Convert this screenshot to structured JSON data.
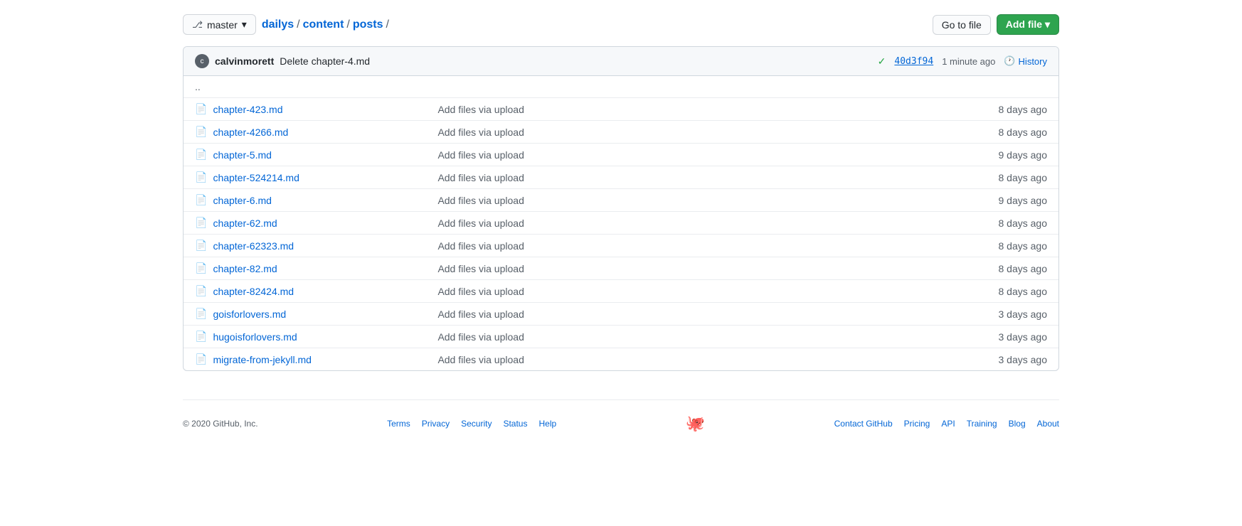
{
  "toolbar": {
    "branch": "master",
    "breadcrumb": [
      {
        "label": "dailys",
        "href": "#"
      },
      {
        "label": "content",
        "href": "#"
      },
      {
        "label": "posts",
        "href": "#"
      }
    ],
    "go_to_file_label": "Go to file",
    "add_file_label": "Add file ▾"
  },
  "commit_header": {
    "author": "calvinmorett",
    "message": "Delete chapter-4.md",
    "hash": "40d3f94",
    "time": "1 minute ago",
    "history_label": "History"
  },
  "parent_dir": "..",
  "files": [
    {
      "name": "chapter-423.md",
      "commit_msg": "Add files via upload",
      "time": "8 days ago"
    },
    {
      "name": "chapter-4266.md",
      "commit_msg": "Add files via upload",
      "time": "8 days ago"
    },
    {
      "name": "chapter-5.md",
      "commit_msg": "Add files via upload",
      "time": "9 days ago"
    },
    {
      "name": "chapter-524214.md",
      "commit_msg": "Add files via upload",
      "time": "8 days ago"
    },
    {
      "name": "chapter-6.md",
      "commit_msg": "Add files via upload",
      "time": "9 days ago"
    },
    {
      "name": "chapter-62.md",
      "commit_msg": "Add files via upload",
      "time": "8 days ago"
    },
    {
      "name": "chapter-62323.md",
      "commit_msg": "Add files via upload",
      "time": "8 days ago"
    },
    {
      "name": "chapter-82.md",
      "commit_msg": "Add files via upload",
      "time": "8 days ago"
    },
    {
      "name": "chapter-82424.md",
      "commit_msg": "Add files via upload",
      "time": "8 days ago"
    },
    {
      "name": "goisforlovers.md",
      "commit_msg": "Add files via upload",
      "time": "3 days ago"
    },
    {
      "name": "hugoisforlovers.md",
      "commit_msg": "Add files via upload",
      "time": "3 days ago"
    },
    {
      "name": "migrate-from-jekyll.md",
      "commit_msg": "Add files via upload",
      "time": "3 days ago"
    }
  ],
  "footer": {
    "copyright": "© 2020 GitHub, Inc.",
    "links": [
      "Terms",
      "Privacy",
      "Security",
      "Status",
      "Help"
    ],
    "right_links": [
      "Contact GitHub",
      "Pricing",
      "API",
      "Training",
      "Blog",
      "About"
    ]
  }
}
